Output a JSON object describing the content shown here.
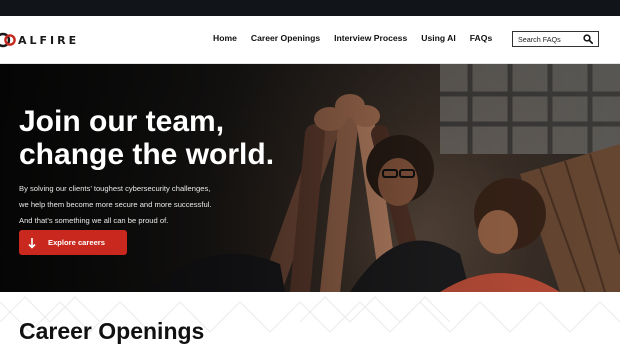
{
  "brand": {
    "logo_text": "ALFIRE",
    "accent": "#c8281d"
  },
  "nav": {
    "items": [
      "Home",
      "Career Openings",
      "Interview Process",
      "Using AI",
      "FAQs"
    ]
  },
  "search": {
    "placeholder": "Search FAQs",
    "icon": "search-icon"
  },
  "hero": {
    "title_line1": "Join our team,",
    "title_line2": "change the world.",
    "body_line1": "By solving our clients’ toughest cybersecurity challenges,",
    "body_line2": "we help them become more secure and more successful.",
    "body_line3": "And that’s something we all can be proud of.",
    "cta_label": "Explore careers",
    "cta_icon": "arrow-down-icon"
  },
  "section": {
    "title": "Career Openings"
  }
}
